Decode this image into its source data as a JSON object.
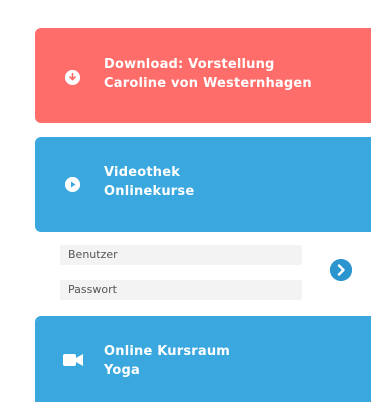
{
  "download": {
    "line1": "Download: Vorstellung",
    "line2": "Caroline von Westernhagen",
    "icon": "download-icon"
  },
  "videothek": {
    "line1": "Videothek",
    "line2": "Onlinekurse",
    "icon": "play-icon"
  },
  "login": {
    "user_placeholder": "Benutzer",
    "pass_placeholder": "Passwort",
    "submit_icon": "chevron-right-icon"
  },
  "kursraum": {
    "line1": "Online Kursraum",
    "line2": "Yoga",
    "icon": "video-camera-icon"
  },
  "colors": {
    "red": "#ff6d6a",
    "blue": "#3aa8df",
    "dark_blue": "#2b95cf"
  }
}
